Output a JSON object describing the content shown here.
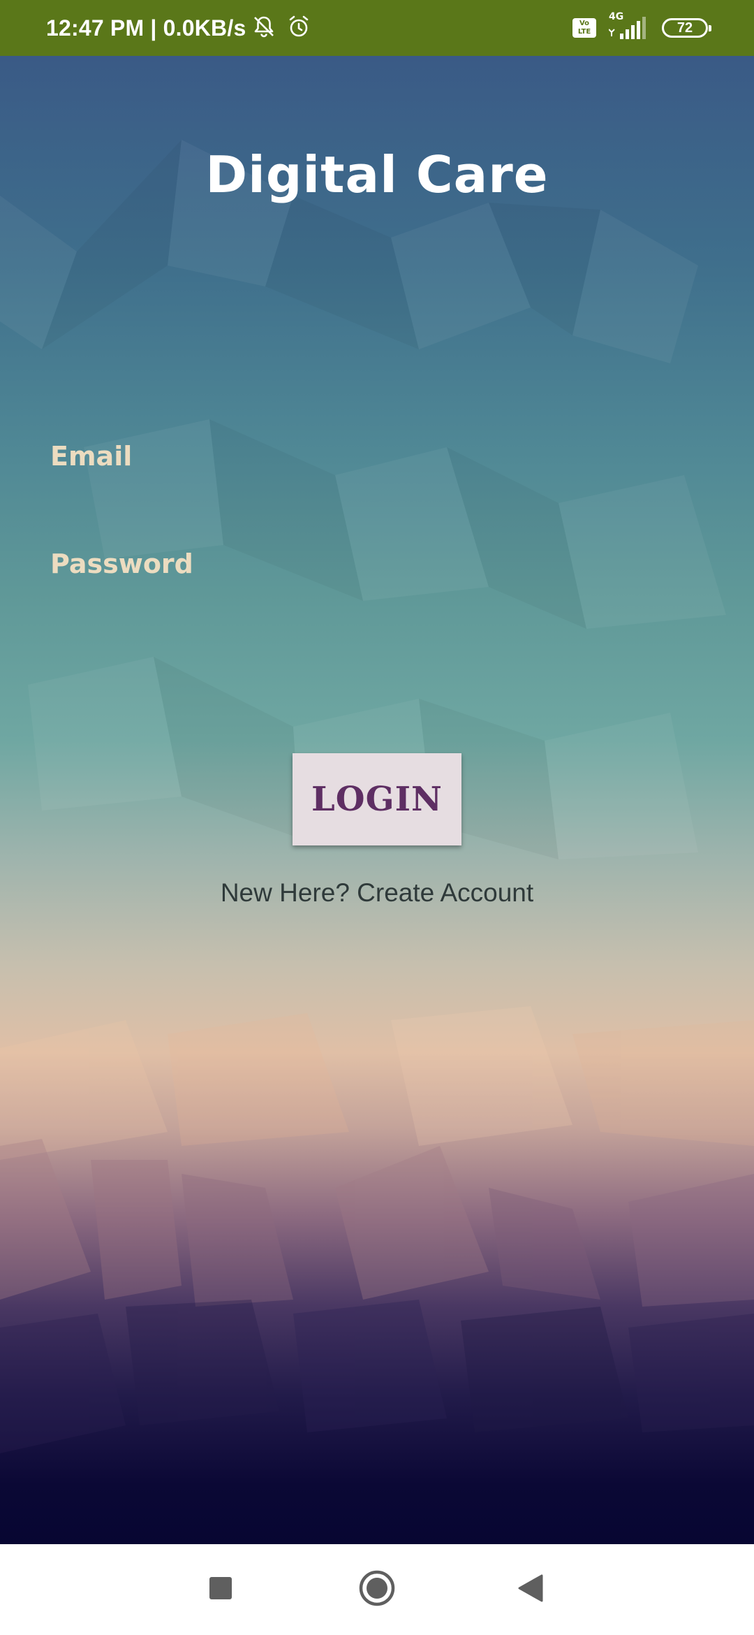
{
  "status_bar": {
    "time": "12:47 PM | 0.0KB/s",
    "left_icons": [
      "mute-bell-icon",
      "alarm-icon"
    ],
    "volte_line1": "Vo",
    "volte_line2": "LTE",
    "network_type": "4G",
    "battery_level": "72",
    "background_color": "#5a7719"
  },
  "app": {
    "title": "Digital Care",
    "email": {
      "placeholder": "Email",
      "value": ""
    },
    "password": {
      "placeholder": "Password",
      "value": ""
    },
    "login_label": "LOGIN",
    "create_account_label": "New Here? Create Account",
    "colors": {
      "title": "#ffffff",
      "field_hint": "#ecdcc0",
      "login_bg": "#e6dde1",
      "login_text": "#5e2e63",
      "link_text": "#2f3a3a"
    }
  },
  "nav_bar": {
    "items": [
      "recents-square-icon",
      "home-circle-icon",
      "back-triangle-icon"
    ]
  }
}
